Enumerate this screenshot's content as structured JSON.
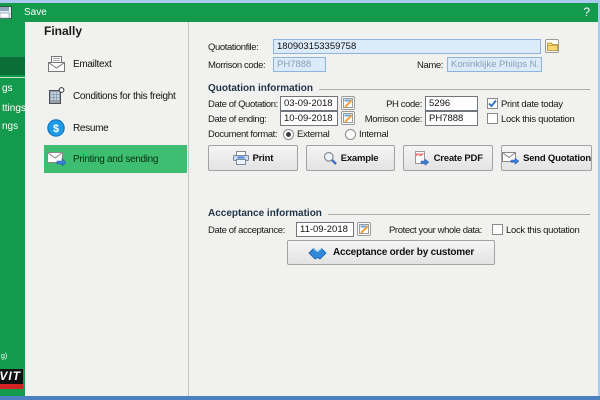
{
  "titlebar": {
    "save_label": "Save",
    "help_label": "?"
  },
  "sidebar": {
    "partial_items": [
      "gs",
      "ttings",
      "ngs"
    ],
    "partial_footer": "g)",
    "logo_text": "VIT"
  },
  "nav": {
    "title": "Finally",
    "items": [
      {
        "label": "Emailtext",
        "icon": "email-letter-icon",
        "selected": false
      },
      {
        "label": "Conditions for this freight",
        "icon": "building-icon",
        "selected": false
      },
      {
        "label": "Resume",
        "icon": "dollar-circle-icon",
        "selected": false
      },
      {
        "label": "Printing and sending",
        "icon": "envelope-send-icon",
        "selected": true
      }
    ]
  },
  "form": {
    "header": {
      "quotationfile_label": "Quotationfile:",
      "quotationfile_value": "180903153359758",
      "morrison_label": "Morrison code:",
      "morrison_value": "PH7888",
      "name_label": "Name:",
      "name_value": "Koninklijke Philips N.V."
    },
    "quotation_info": {
      "title": "Quotation information",
      "date_of_quotation_label": "Date of Quotation:",
      "date_of_quotation_value": "03-09-2018",
      "date_of_ending_label": "Date of ending:",
      "date_of_ending_value": "10-09-2018",
      "document_format_label": "Document format:",
      "format_external": "External",
      "format_internal": "Internal",
      "ph_code_label": "PH code:",
      "ph_code_value": "5296",
      "morrison_code_label": "Morrison code:",
      "morrison_code_value": "PH7888",
      "print_date_today_label": "Print date today",
      "print_date_today_checked": true,
      "lock_quotation_label": "Lock this quotation",
      "lock_quotation_checked": false
    },
    "action_buttons": [
      {
        "label": "Print",
        "icon": "printer-icon"
      },
      {
        "label": "Example",
        "icon": "magnifier-icon"
      },
      {
        "label": "Create PDF",
        "icon": "pdf-file-icon"
      },
      {
        "label": "Send Quotation",
        "icon": "send-envelope-icon"
      }
    ],
    "acceptance_info": {
      "title": "Acceptance information",
      "date_of_acceptance_label": "Date of acceptance:",
      "date_of_acceptance_value": "11-09-2018",
      "protect_label": "Protect your whole data:",
      "lock_quotation_label": "Lock this quotation",
      "lock_quotation_checked": false,
      "accept_button_label": "Acceptance order by customer"
    }
  },
  "icons": {
    "dollar": "$",
    "pdf_badge": "PDF"
  },
  "colors": {
    "titlebar_green": "#149a4c",
    "sidebar_selected_green": "#0a6f37",
    "nav_selected_green": "#3dbe71",
    "window_border_blue": "#a9cbf0",
    "bottom_bar_blue": "#4d80c0",
    "input_blue_bg": "#dcebfa",
    "input_blue_border": "#8fb2e0",
    "check_blue": "#2c6fc4",
    "logo_red": "#d42323"
  }
}
